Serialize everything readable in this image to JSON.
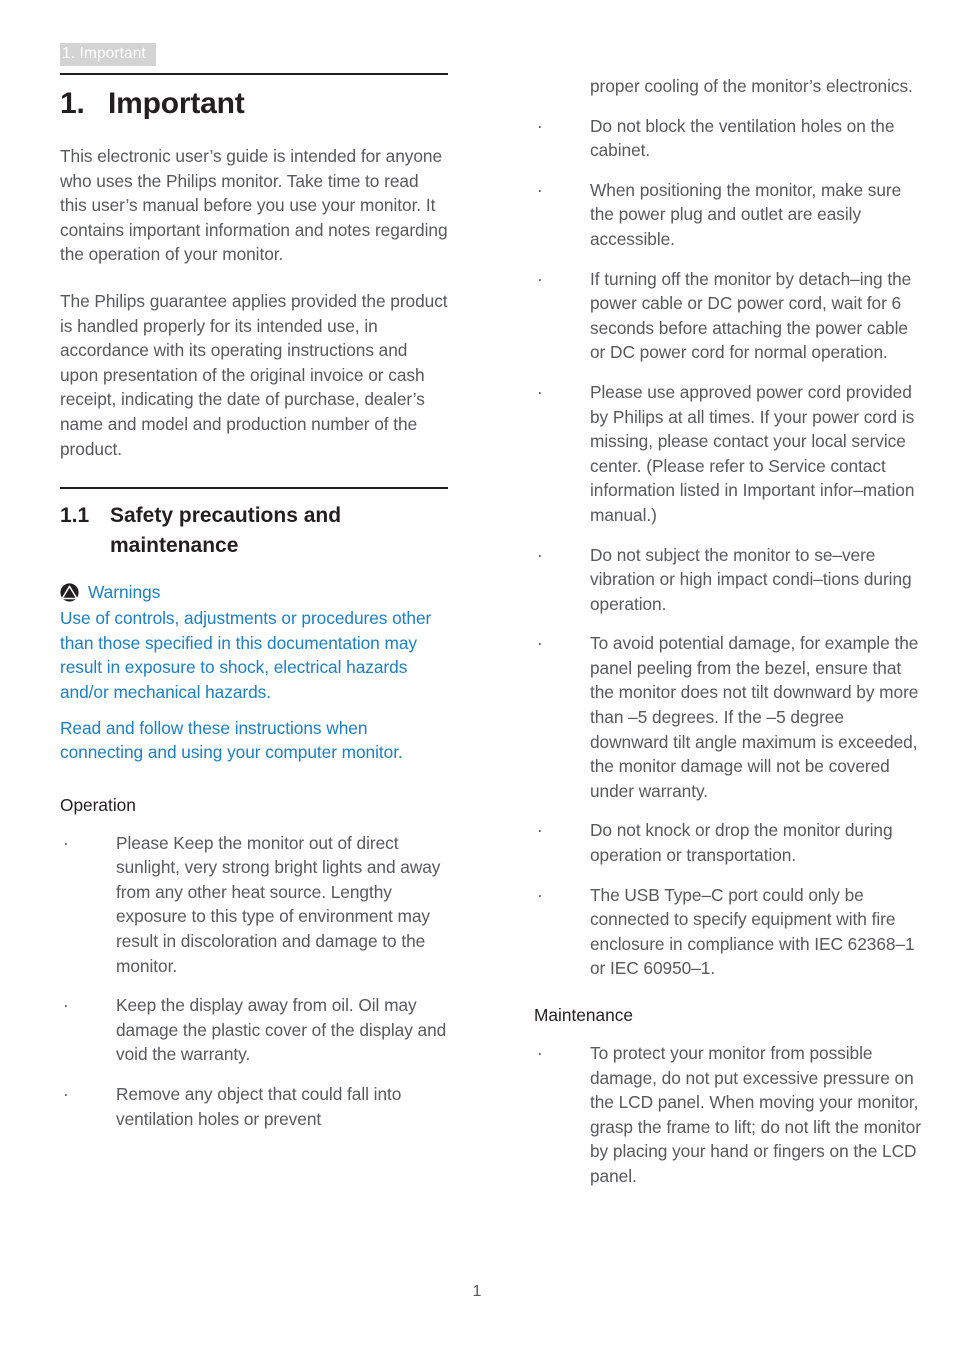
{
  "running_header": "1. Important",
  "chapter": {
    "number": "1.",
    "title": "Important"
  },
  "intro_paragraphs": [
    "This electronic user’s guide is intended for anyone who uses the Philips monitor. Take time to read this user’s manual before you use your monitor. It contains important information and notes regarding the operation of your monitor.",
    "The Philips guarantee applies provided the product is handled properly for its intended use, in accordance with its operating instructions and upon presentation of the original invoice or cash receipt, indicating the date of purchase, dealer’s name and model and production number of the product."
  ],
  "section": {
    "number": "1.1",
    "title": "Safety precautions and maintenance"
  },
  "warning": {
    "icon": "warning-triangle-icon",
    "label": "Warnings",
    "paragraph_1": "Use of controls, adjustments or procedures other than those specified in this documentation may result in exposure to shock, electrical hazards and/or mechanical hazards.",
    "paragraph_2": "Read and follow these instructions when connecting and using your computer monitor."
  },
  "operation": {
    "heading": "Operation",
    "bullets": [
      "Please Keep the monitor out of direct sunlight, very strong bright lights and away from any other heat source. Lengthy exposure to this type of environment may result in discoloration and damage to the monitor.",
      "Keep the display away from oil. Oil may damage the plastic cover of the display and void the warranty.",
      "Remove any object that could fall into ventilation holes or prevent"
    ],
    "bullet_continuation": "proper cooling of the monitor’s electronics.",
    "bullets_continued": [
      "Do not block the ventilation holes on the cabinet.",
      "When positioning the monitor, make sure the power plug and outlet are easily accessible.",
      "If turning off the monitor by detach–ing the power cable or DC power cord, wait for 6 seconds before attaching the power cable or DC power cord for normal operation.",
      "Please use approved power cord provided by Philips at all times. If your power cord is missing, please contact your local service center. (Please refer to Service contact information listed in Important infor–mation manual.)",
      "Do not subject the monitor to se–vere vibration or high impact condi–tions during operation.",
      "To avoid potential damage, for example the panel peeling from the bezel, ensure that the monitor does not tilt downward by more than –5 degrees. If the –5 degree downward tilt angle maximum is exceeded, the monitor damage will not be covered under warranty.",
      "Do not knock or drop the monitor during operation or transportation.",
      "The USB Type–C port could only be connected to specify equipment with fire enclosure in compliance with IEC 62368–1 or IEC 60950–1."
    ]
  },
  "maintenance": {
    "heading": "Maintenance",
    "bullets": [
      "To protect your monitor from possible damage, do not put excessive pressure on the LCD panel. When moving your monitor, grasp the frame to lift; do not lift the monitor by placing your hand or fingers on the LCD panel."
    ]
  },
  "bullet_marker": "·",
  "page_number": "1",
  "colors": {
    "body_text": "#58595b",
    "heading_text": "#231f20",
    "warning_blue": "#1b80c4",
    "header_band": "#d3d3d3",
    "header_text": "#ffffff"
  }
}
